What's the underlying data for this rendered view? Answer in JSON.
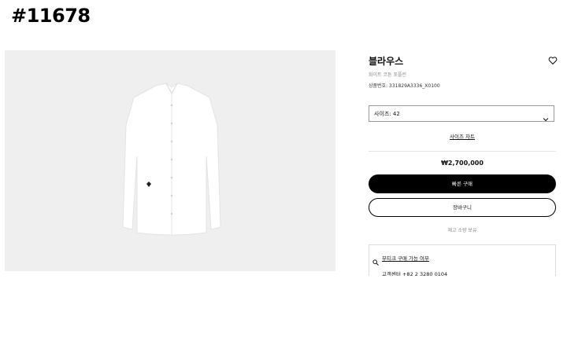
{
  "post": {
    "number": "#11678"
  },
  "product": {
    "title": "블라우스",
    "subtitle": "화이트 코튼 포플린",
    "reference": "상품번호: 331829A3336_X0100",
    "size_label": "사이즈: 42",
    "size_guide": "사이즈 차트",
    "price": "₩2,700,000",
    "buy_button": "빠른 구매",
    "cart_button": "장바구니",
    "stock_note": "재고 소량 보유"
  },
  "boutique": {
    "availability_link": "부티크 구매 가능 여부",
    "customer_center": "고객센터 +82 2 3280 0104"
  },
  "icons": {
    "wishlist": "heart-icon",
    "dropdown": "chevron-down-icon",
    "search": "search-icon",
    "phone": "phone-icon"
  },
  "colors": {
    "image_bg": "#efefef",
    "button_primary": "#000000"
  }
}
